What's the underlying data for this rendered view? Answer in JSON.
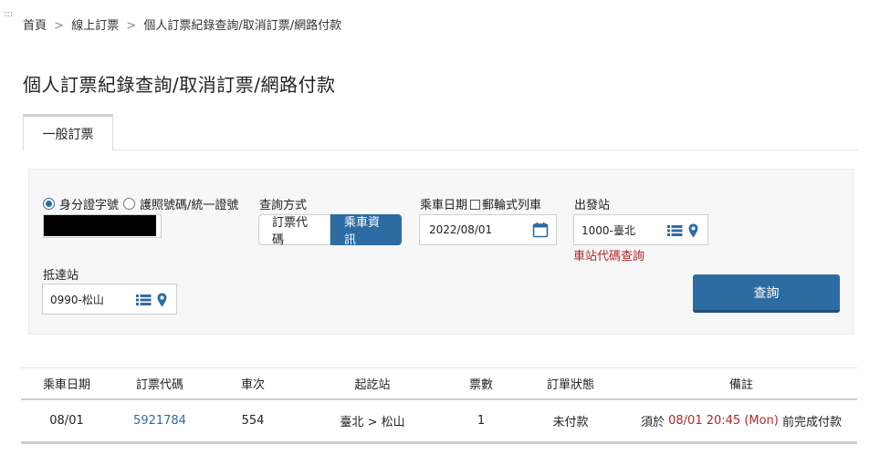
{
  "breadcrumb": {
    "items": [
      "首頁",
      "線上訂票",
      "個人訂票紀錄查詢/取消訂票/網路付款"
    ],
    "separator": ">"
  },
  "page": {
    "title": "個人訂票紀錄查詢/取消訂票/網路付款",
    "tab": "一般訂票"
  },
  "form": {
    "id_type": {
      "option_id": "身分證字號",
      "option_passport": "護照號碼/統一證號",
      "selected": "身分證字號"
    },
    "query_method": {
      "label": "查詢方式",
      "option_code": "訂票代碼",
      "option_train": "乘車資訊",
      "selected": "乘車資訊"
    },
    "ride_date": {
      "label": "乘車日期",
      "postal_train_label": "郵輪式列車",
      "value": "2022/08/01"
    },
    "departure": {
      "label": "出發站",
      "value": "1000-臺北"
    },
    "station_code_link": "車站代碼查詢",
    "arrival": {
      "label": "抵達站",
      "value": "0990-松山"
    },
    "query_button": "查詢"
  },
  "results": {
    "headers": [
      "乘車日期",
      "訂票代碼",
      "車次",
      "起訖站",
      "票數",
      "訂單狀態",
      "備註"
    ],
    "rows": [
      {
        "date": "08/01",
        "code": "5921784",
        "train": "554",
        "route": "臺北 > 松山",
        "tickets": "1",
        "status": "未付款",
        "note_prefix": "須於",
        "note_deadline": "08/01 20:45 (Mon)",
        "note_suffix": "前完成付款"
      }
    ]
  },
  "colors": {
    "accent": "#2d6ca3",
    "warning": "#b3262b"
  }
}
